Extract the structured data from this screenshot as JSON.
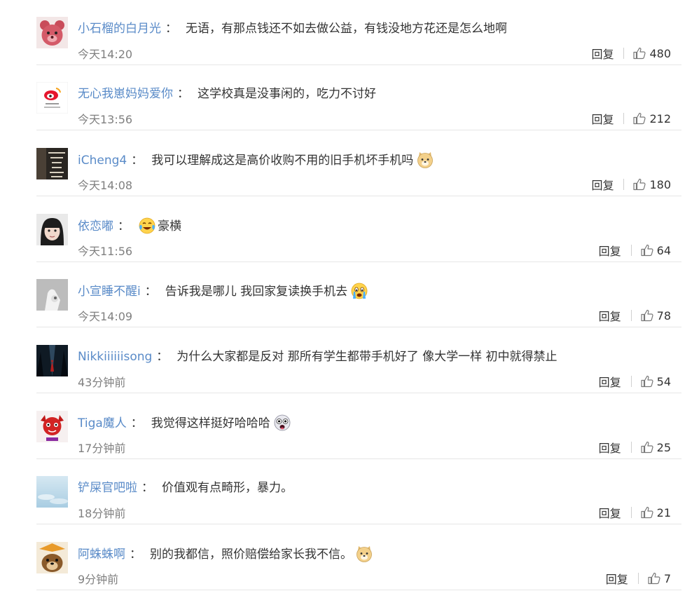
{
  "colors": {
    "username": "#5a8bc8",
    "text": "#333333",
    "time": "#808080",
    "divider": "#e6e6e6"
  },
  "reply_label": "回复",
  "comments": [
    {
      "user": "小石榴的白月光",
      "colon": "：",
      "text": "无语，有那点钱还不如去做公益，有钱没地方花还是怎么地啊",
      "time": "今天14:20",
      "likes": "480",
      "avatar": "pink-bear-avatar"
    },
    {
      "user": "无心我崽妈妈爱你",
      "colon": "：",
      "text": "这学校真是没事闲的，吃力不讨好",
      "time": "今天13:56",
      "likes": "212",
      "avatar": "weibo-logo-avatar"
    },
    {
      "user": "iCheng4",
      "colon": "：",
      "text": "我可以理解成这是高价收购不用的旧手机坏手机吗",
      "time": "今天14:08",
      "likes": "180",
      "avatar": "strength-text-avatar",
      "emoji_after": "doge-emoji"
    },
    {
      "user": "依恋嘟",
      "colon": "：",
      "text": "豪横",
      "time": "今天11:56",
      "likes": "64",
      "avatar": "girl-photo-avatar",
      "emoji_before": "laugh-cry-emoji"
    },
    {
      "user": "小宣睡不醒i",
      "colon": "：",
      "text": "告诉我是哪儿 我回家复读换手机去",
      "time": "今天14:09",
      "likes": "78",
      "avatar": "hand-photo-avatar",
      "emoji_after": "crying-emoji"
    },
    {
      "user": "Nikkiiiiiisong",
      "colon": "：",
      "text": "为什么大家都是反对 那所有学生都带手机好了 像大学一样 初中就得禁止",
      "time": "43分钟前",
      "likes": "54",
      "avatar": "dark-forest-avatar"
    },
    {
      "user": "Tiga魔人",
      "colon": "：",
      "text": "我觉得这样挺好哈哈哈",
      "time": "17分钟前",
      "likes": "25",
      "avatar": "red-cartoon-avatar",
      "emoji_after": "crazy-face-emoji"
    },
    {
      "user": "铲屎官吧啦",
      "colon": "：",
      "text": "价值观有点畸形，暴力。",
      "time": "18分钟前",
      "likes": "21",
      "avatar": "blue-sky-avatar"
    },
    {
      "user": "阿蛛蛛啊",
      "colon": "：",
      "text": "别的我都信，照价赔偿给家长我不信。",
      "time": "9分钟前",
      "likes": "7",
      "avatar": "cartoon-dog-avatar",
      "emoji_after": "doge-emoji"
    }
  ]
}
